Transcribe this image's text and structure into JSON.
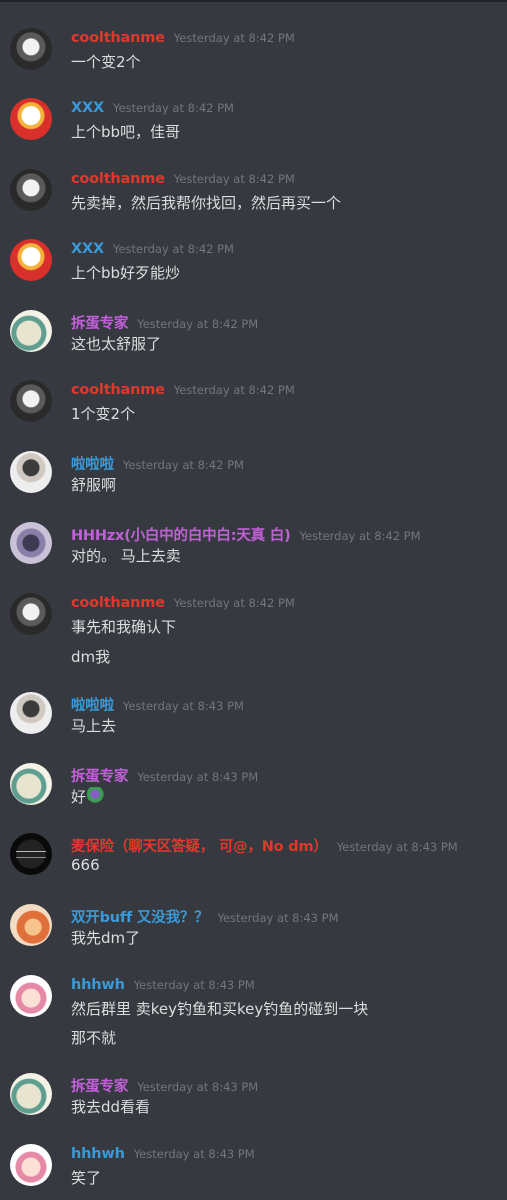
{
  "colors": {
    "background": "#36393f",
    "timestamp": "#72767d",
    "text": "#dcddde"
  },
  "messages": [
    {
      "author": "coolthanme",
      "color": "#e0392b",
      "avatar": "wolf-avatar",
      "timestamp": "Yesterday at 8:42 PM",
      "lines": [
        "一个变2个"
      ]
    },
    {
      "author": "XXX",
      "color": "#3a9ad9",
      "avatar": "ding-avatar",
      "timestamp": "Yesterday at 8:42 PM",
      "lines": [
        "上个bb吧，佳哥"
      ]
    },
    {
      "author": "coolthanme",
      "color": "#e0392b",
      "avatar": "wolf-avatar",
      "timestamp": "Yesterday at 8:42 PM",
      "lines": [
        "先卖掉，然后我帮你找回，然后再买一个"
      ]
    },
    {
      "author": "XXX",
      "color": "#3a9ad9",
      "avatar": "ding-avatar",
      "timestamp": "Yesterday at 8:42 PM",
      "lines": [
        "上个bb好歹能炒"
      ]
    },
    {
      "author": "拆蛋专家",
      "color": "#c260d9",
      "avatar": "snorlax-avatar",
      "timestamp": "Yesterday at 8:42 PM",
      "lines": [
        "这也太舒服了"
      ]
    },
    {
      "author": "coolthanme",
      "color": "#e0392b",
      "avatar": "wolf-avatar",
      "timestamp": "Yesterday at 8:42 PM",
      "lines": [
        "1个变2个"
      ]
    },
    {
      "author": "啦啦啦",
      "color": "#3a9ad9",
      "avatar": "girl-avatar",
      "timestamp": "Yesterday at 8:42 PM",
      "lines": [
        "舒服啊"
      ]
    },
    {
      "author": "HHHzx(小白中的白中白:天真 白)",
      "color": "#c260d9",
      "avatar": "hhhzx-avatar",
      "timestamp": "Yesterday at 8:42 PM",
      "lines": [
        "对的。 马上去卖"
      ]
    },
    {
      "author": "coolthanme",
      "color": "#e0392b",
      "avatar": "wolf-avatar",
      "timestamp": "Yesterday at 8:42 PM",
      "lines": [
        "事先和我确认下",
        "dm我"
      ]
    },
    {
      "author": "啦啦啦",
      "color": "#3a9ad9",
      "avatar": "girl-avatar",
      "timestamp": "Yesterday at 8:43 PM",
      "lines": [
        "马上去"
      ]
    },
    {
      "author": "拆蛋专家",
      "color": "#c260d9",
      "avatar": "snorlax-avatar",
      "timestamp": "Yesterday at 8:43 PM",
      "lines": [
        "好"
      ],
      "emoji": "plant-emoji"
    },
    {
      "author": "麦保险（聊天区答疑， 可@，No dm）",
      "color": "#e0392b",
      "avatar": "signature-avatar",
      "timestamp": "Yesterday at 8:43 PM",
      "lines": [
        "666"
      ]
    },
    {
      "author": "双开buff 又没我？？",
      "color": "#3a9ad9",
      "avatar": "fox-avatar",
      "timestamp": "Yesterday at 8:43 PM",
      "lines": [
        "我先dm了"
      ]
    },
    {
      "author": "hhhwh",
      "color": "#3a9ad9",
      "avatar": "anime-avatar",
      "timestamp": "Yesterday at 8:43 PM",
      "lines": [
        "然后群里 卖key钓鱼和买key钓鱼的碰到一块",
        "那不就"
      ]
    },
    {
      "author": "拆蛋专家",
      "color": "#c260d9",
      "avatar": "snorlax-avatar",
      "timestamp": "Yesterday at 8:43 PM",
      "lines": [
        "我去dd看看"
      ]
    },
    {
      "author": "hhhwh",
      "color": "#3a9ad9",
      "avatar": "anime-avatar",
      "timestamp": "Yesterday at 8:43 PM",
      "lines": [
        "笑了"
      ]
    }
  ]
}
